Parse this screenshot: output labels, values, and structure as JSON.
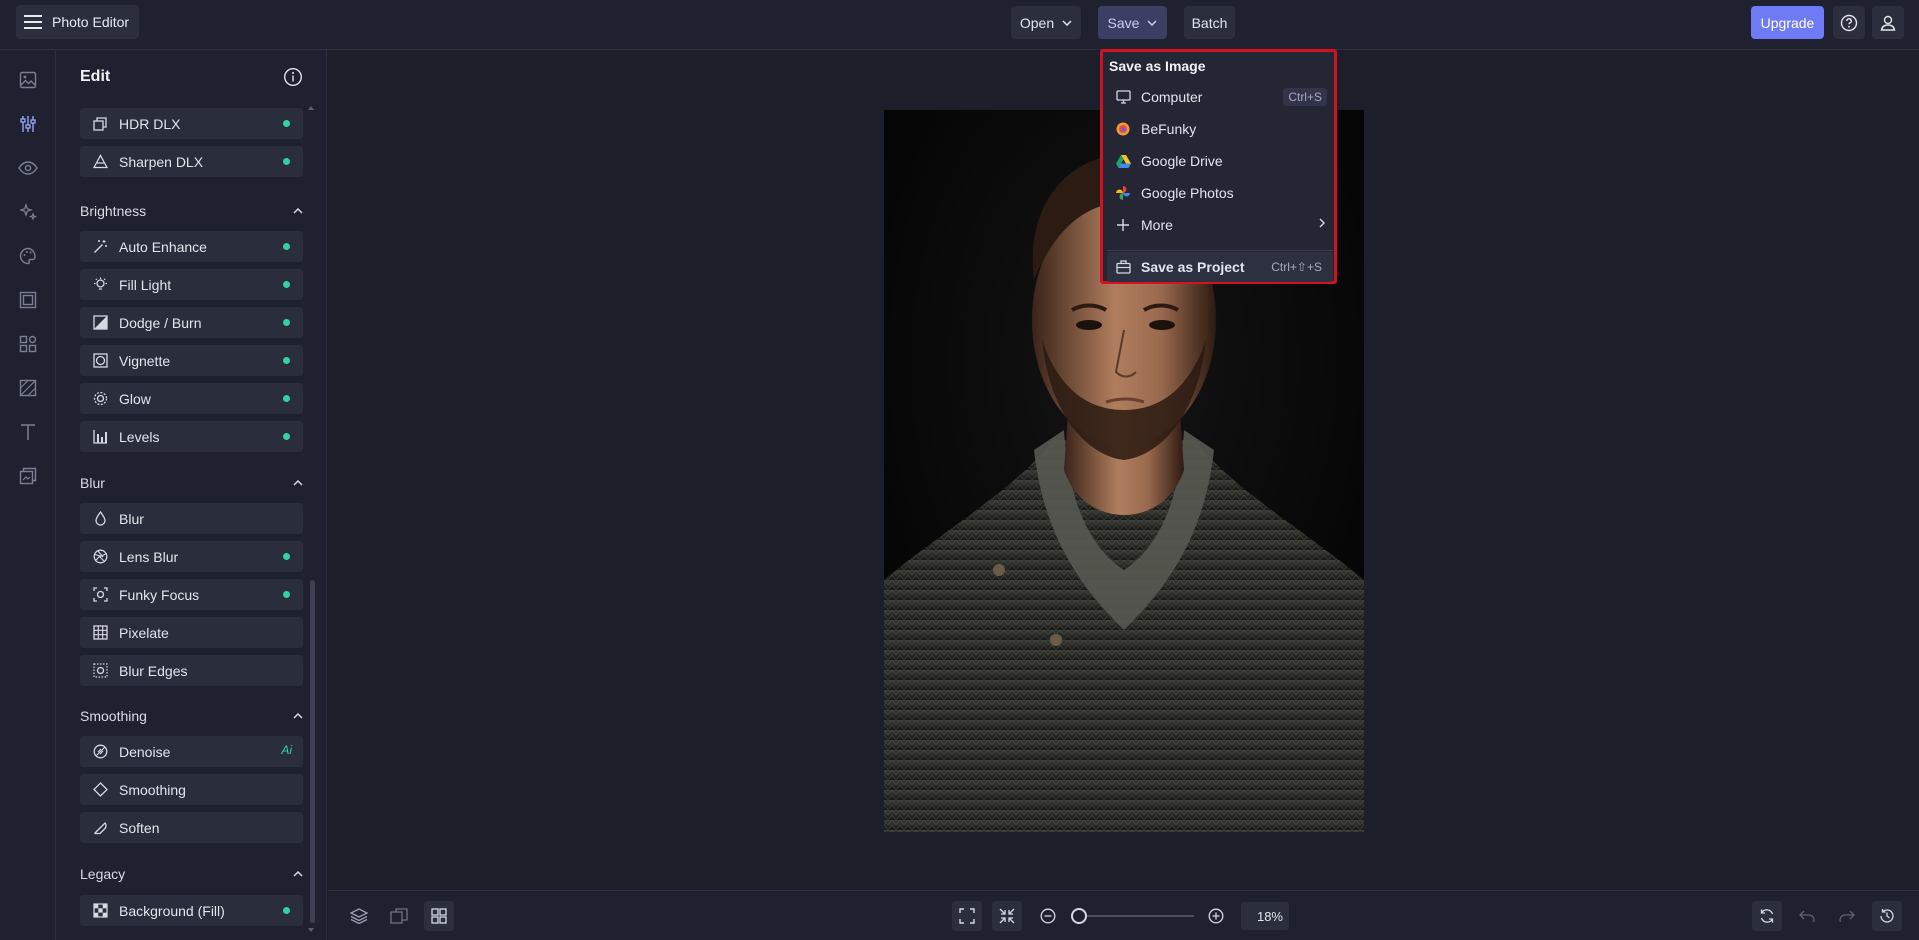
{
  "app": {
    "menu_label": "Photo Editor"
  },
  "toolbar": {
    "open_label": "Open",
    "save_label": "Save",
    "batch_label": "Batch",
    "upgrade_label": "Upgrade"
  },
  "rail": {
    "icons": [
      "image-icon",
      "sliders-icon",
      "eye-icon",
      "sparkle-icon",
      "palette-icon",
      "frame-icon",
      "shapes-icon",
      "texture-icon",
      "text-icon",
      "layers-icon"
    ]
  },
  "panel": {
    "title": "Edit",
    "top_tools": [
      {
        "label": "HDR DLX",
        "icon": "hdr-icon",
        "status": "dot"
      },
      {
        "label": "Sharpen DLX",
        "icon": "sharpen-icon",
        "status": "dot"
      }
    ],
    "sections": [
      {
        "title": "Brightness",
        "tools": [
          {
            "label": "Auto Enhance",
            "icon": "magic-wand-icon",
            "status": "dot"
          },
          {
            "label": "Fill Light",
            "icon": "bulb-icon",
            "status": "dot"
          },
          {
            "label": "Dodge / Burn",
            "icon": "dodge-burn-icon",
            "status": "dot"
          },
          {
            "label": "Vignette",
            "icon": "vignette-icon",
            "status": "dot"
          },
          {
            "label": "Glow",
            "icon": "glow-icon",
            "status": "dot"
          },
          {
            "label": "Levels",
            "icon": "levels-icon",
            "status": "dot"
          }
        ]
      },
      {
        "title": "Blur",
        "tools": [
          {
            "label": "Blur",
            "icon": "drop-icon",
            "status": ""
          },
          {
            "label": "Lens Blur",
            "icon": "aperture-icon",
            "status": "dot"
          },
          {
            "label": "Funky Focus",
            "icon": "focus-icon",
            "status": "dot"
          },
          {
            "label": "Pixelate",
            "icon": "grid-icon",
            "status": ""
          },
          {
            "label": "Blur Edges",
            "icon": "blur-edges-icon",
            "status": ""
          }
        ]
      },
      {
        "title": "Smoothing",
        "tools": [
          {
            "label": "Denoise",
            "icon": "denoise-icon",
            "status": "ai",
            "badge": "Ai"
          },
          {
            "label": "Smoothing",
            "icon": "diamond-icon",
            "status": ""
          },
          {
            "label": "Soften",
            "icon": "feather-icon",
            "status": ""
          }
        ]
      },
      {
        "title": "Legacy",
        "tools": [
          {
            "label": "Background (Fill)",
            "icon": "checker-icon",
            "status": "dot"
          }
        ]
      }
    ]
  },
  "save_menu": {
    "heading": "Save as Image",
    "items": [
      {
        "label": "Computer",
        "icon": "monitor-icon",
        "shortcut": "Ctrl+S"
      },
      {
        "label": "BeFunky",
        "icon": "befunky-icon",
        "shortcut": ""
      },
      {
        "label": "Google Drive",
        "icon": "google-drive-icon",
        "shortcut": ""
      },
      {
        "label": "Google Photos",
        "icon": "google-photos-icon",
        "shortcut": ""
      },
      {
        "label": "More",
        "icon": "plus-icon",
        "shortcut": ""
      }
    ],
    "project": {
      "label": "Save as Project",
      "icon": "project-icon",
      "shortcut": "Ctrl+⇧+S"
    }
  },
  "bottom": {
    "zoom_value": "18%",
    "zoom_level": 0.0
  },
  "colors": {
    "accent": "#6f7bf5",
    "status_dot": "#2fd3a4",
    "highlight_border": "#d4121f",
    "background": "#1c1e2a",
    "panel": "#1f2130"
  }
}
